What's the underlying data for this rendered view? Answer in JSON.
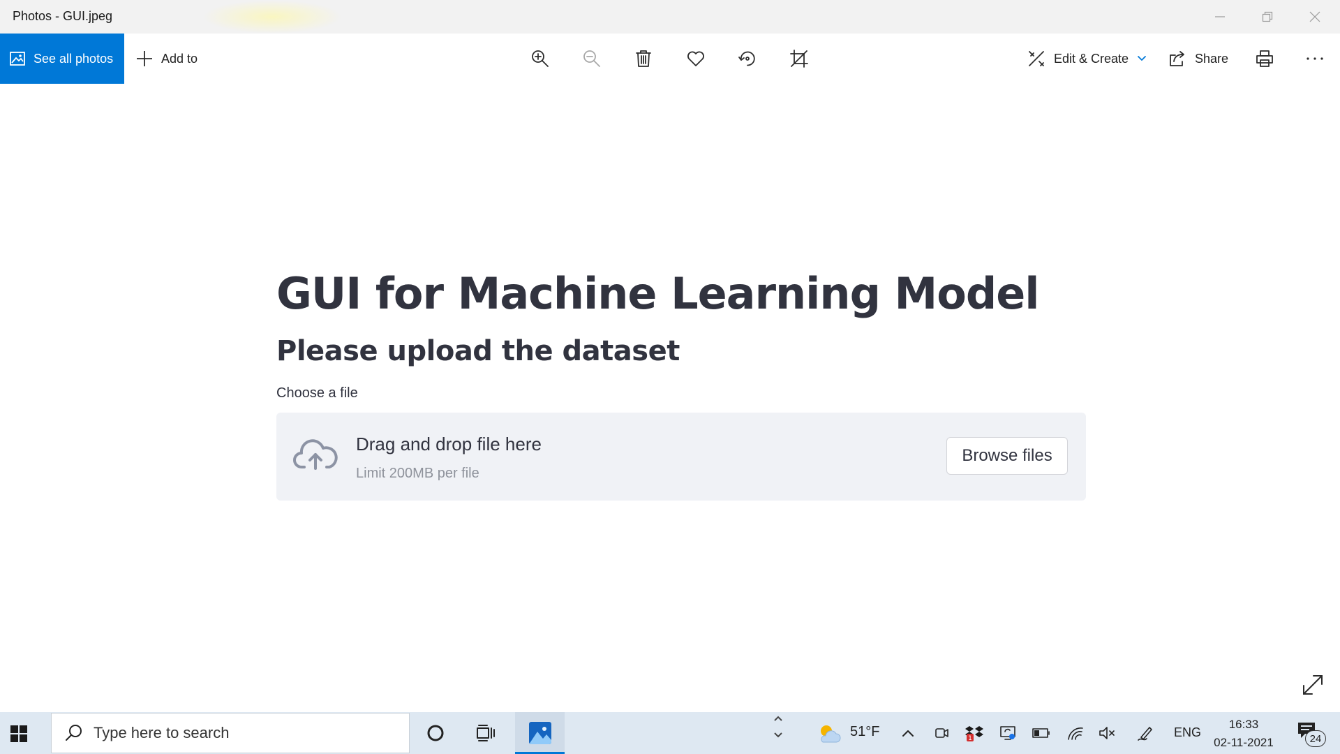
{
  "window": {
    "title": "Photos - GUI.jpeg"
  },
  "toolbar": {
    "see_all_label": "See all photos",
    "add_to_label": "Add to",
    "edit_create_label": "Edit & Create",
    "share_label": "Share",
    "accent_color": "#0078d7"
  },
  "image": {
    "heading": "GUI for Machine Learning Model",
    "subheading": "Please upload the dataset",
    "uploader_label": "Choose a file",
    "dropzone_main": "Drag and drop file here",
    "dropzone_limit": "Limit 200MB per file",
    "browse_label": "Browse files"
  },
  "taskbar": {
    "search_placeholder": "Type here to search",
    "temperature": "51°F",
    "language": "ENG",
    "time": "16:33",
    "date": "02-11-2021",
    "notification_count": "24"
  }
}
